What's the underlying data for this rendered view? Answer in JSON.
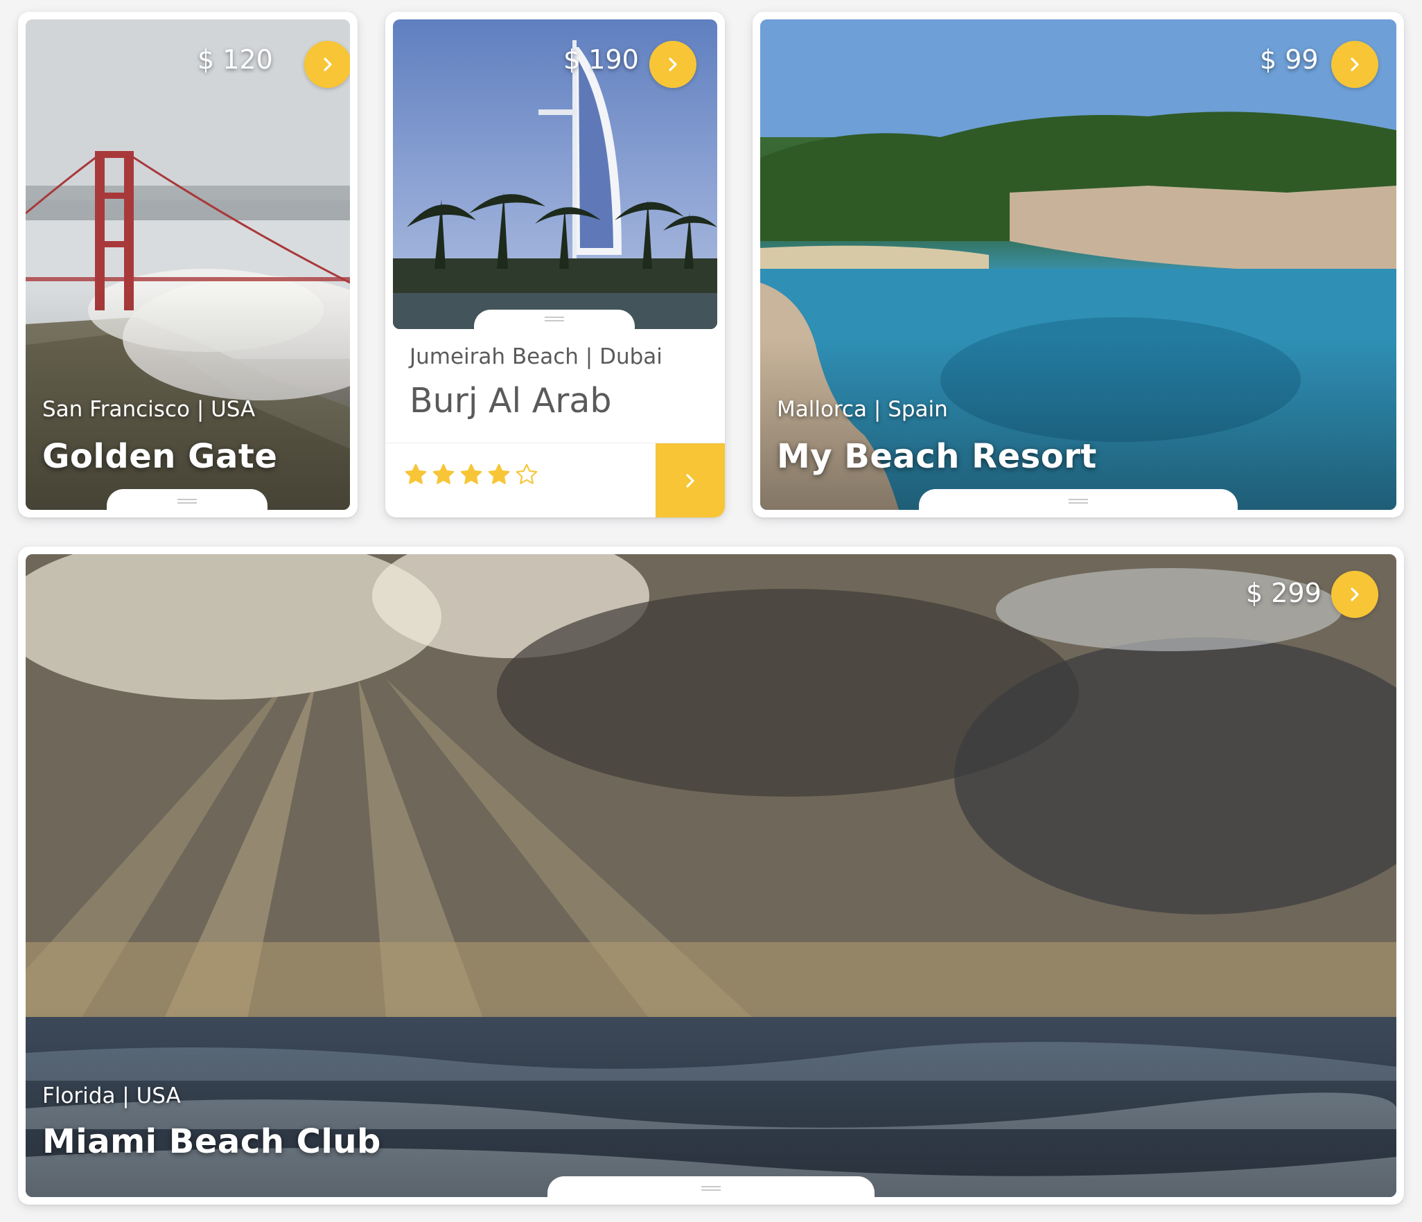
{
  "cards": [
    {
      "price": "$ 120",
      "location": "San Francisco | USA",
      "title": "Golden Gate"
    },
    {
      "price": "$ 190",
      "location": "Jumeirah Beach | Dubai",
      "title": "Burj Al Arab",
      "rating": 4,
      "rating_max": 5
    },
    {
      "price": "$ 99",
      "location": "Mallorca | Spain",
      "title": "My Beach Resort"
    },
    {
      "price": "$ 299",
      "location": "Florida | USA",
      "title": "Miami Beach Club"
    }
  ],
  "colors": {
    "accent": "#f7c536",
    "card_bg": "#ffffff",
    "page_bg": "#f4f4f5",
    "subtitle_text": "#5a5a5a"
  },
  "icons": {
    "next": "chevron-right-icon",
    "star": "star-icon",
    "handle": "drag-handle-icon"
  }
}
